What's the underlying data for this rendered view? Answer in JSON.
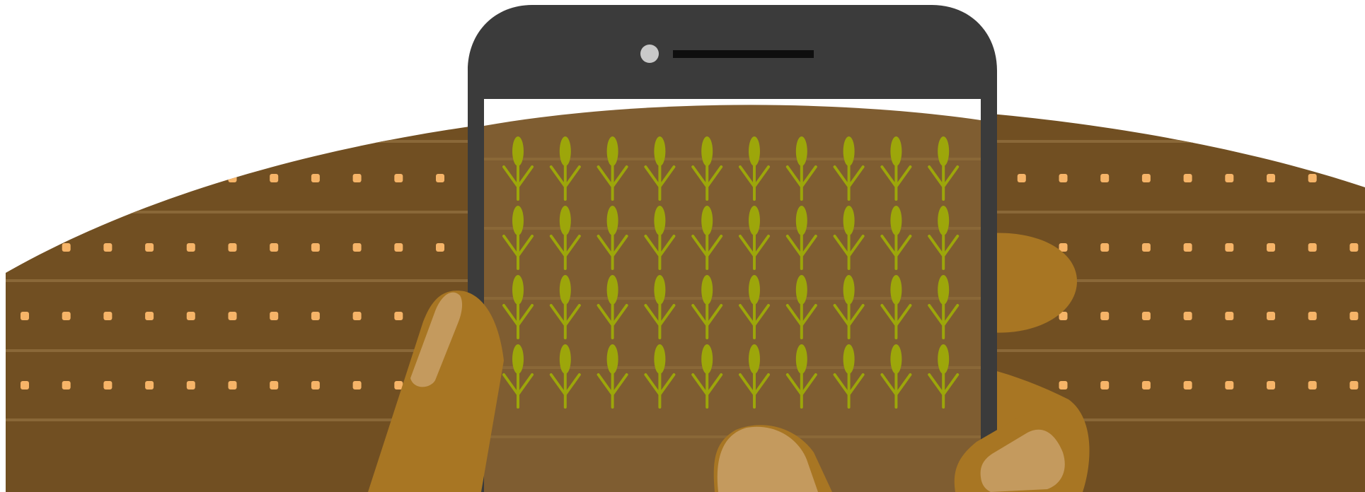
{
  "scene": {
    "subject": "hands-holding-phone-over-seeded-field",
    "colors": {
      "background": "#ffffff",
      "soil": "#714f22",
      "soil_screen": "#7f5d31",
      "furrow": "#8a6838",
      "seed": "#f6b468",
      "sprout": "#9da60a",
      "phone_body": "#3b3b3b",
      "phone_speaker": "#0e0e0e",
      "phone_camera": "#c9c9c9",
      "skin": "#a87623",
      "skin_highlight": "#c49a5e"
    },
    "field": {
      "seed_rows": 4,
      "sprout_grid": {
        "rows": 4,
        "cols": 10
      }
    }
  }
}
